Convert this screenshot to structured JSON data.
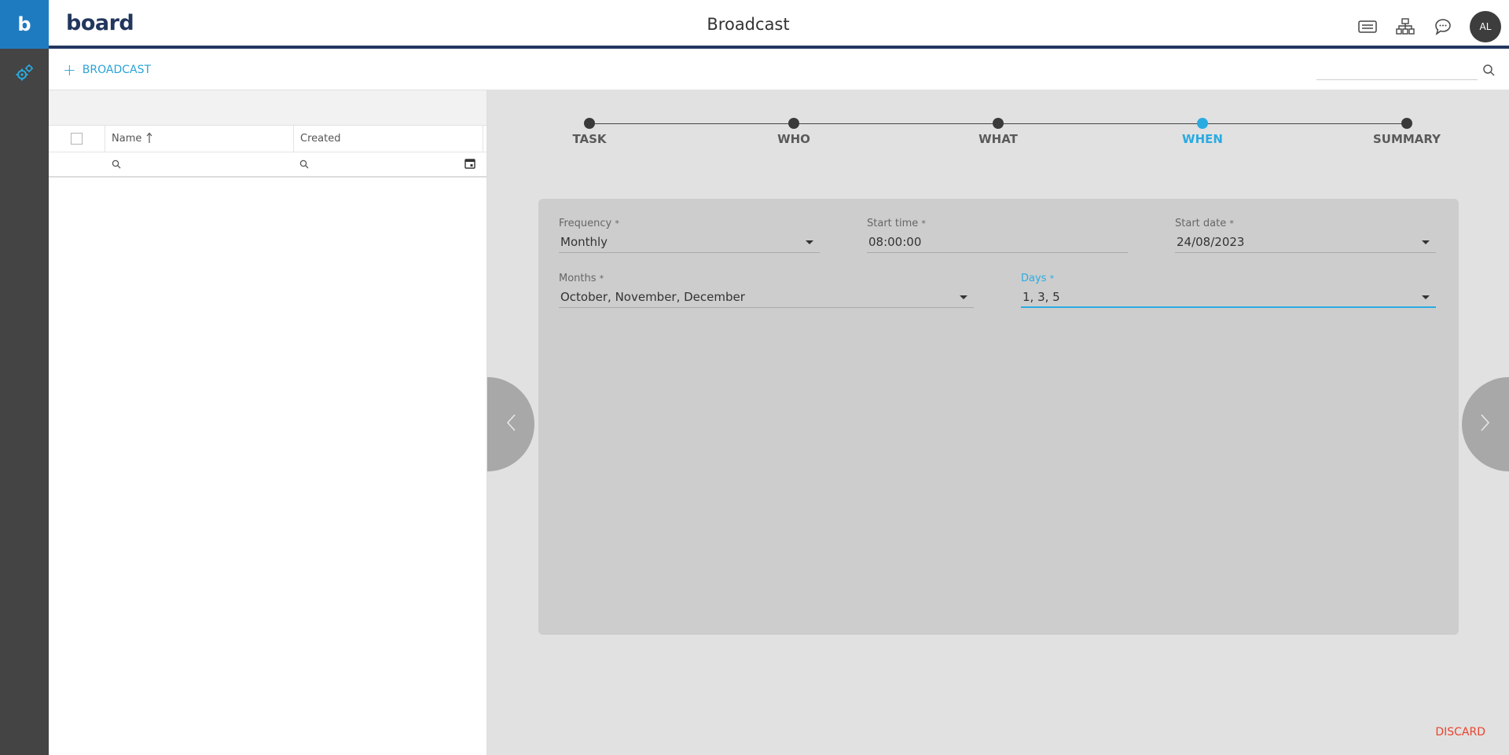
{
  "app": {
    "logo_letter": "b",
    "brand_name": "board",
    "page_title": "Broadcast",
    "user_initials": "AL"
  },
  "toolbar": {
    "add_label": "BROADCAST",
    "search_placeholder": ""
  },
  "list": {
    "columns": [
      {
        "label": "Name",
        "sort": "ascending"
      },
      {
        "label": "Created"
      }
    ],
    "rows": []
  },
  "wizard": {
    "steps": [
      {
        "label": "TASK",
        "state": "done"
      },
      {
        "label": "WHO",
        "state": "done"
      },
      {
        "label": "WHAT",
        "state": "done"
      },
      {
        "label": "WHEN",
        "state": "active"
      },
      {
        "label": "SUMMARY",
        "state": "pending"
      }
    ],
    "fields": {
      "frequency": {
        "label": "Frequency",
        "value": "Monthly"
      },
      "start_time": {
        "label": "Start time",
        "value": "08:00:00"
      },
      "start_date": {
        "label": "Start date",
        "value": "24/08/2023"
      },
      "months": {
        "label": "Months",
        "value": "October, November, December"
      },
      "days": {
        "label": "Days",
        "value": "1, 3, 5"
      }
    },
    "required_mark": "*",
    "discard_label": "DISCARD"
  },
  "colors": {
    "accent": "#29abe2",
    "brand_navy": "#22375e",
    "danger": "#e8442e",
    "rail": "#444444",
    "wizard_bg": "#e1e1e1",
    "card_bg": "#cdcdcd"
  },
  "icons": {
    "rail": [
      "board-logo-icon",
      "settings-gears-icon"
    ],
    "top": [
      "keyboard-icon",
      "sitemap-icon",
      "chat-icon"
    ]
  }
}
